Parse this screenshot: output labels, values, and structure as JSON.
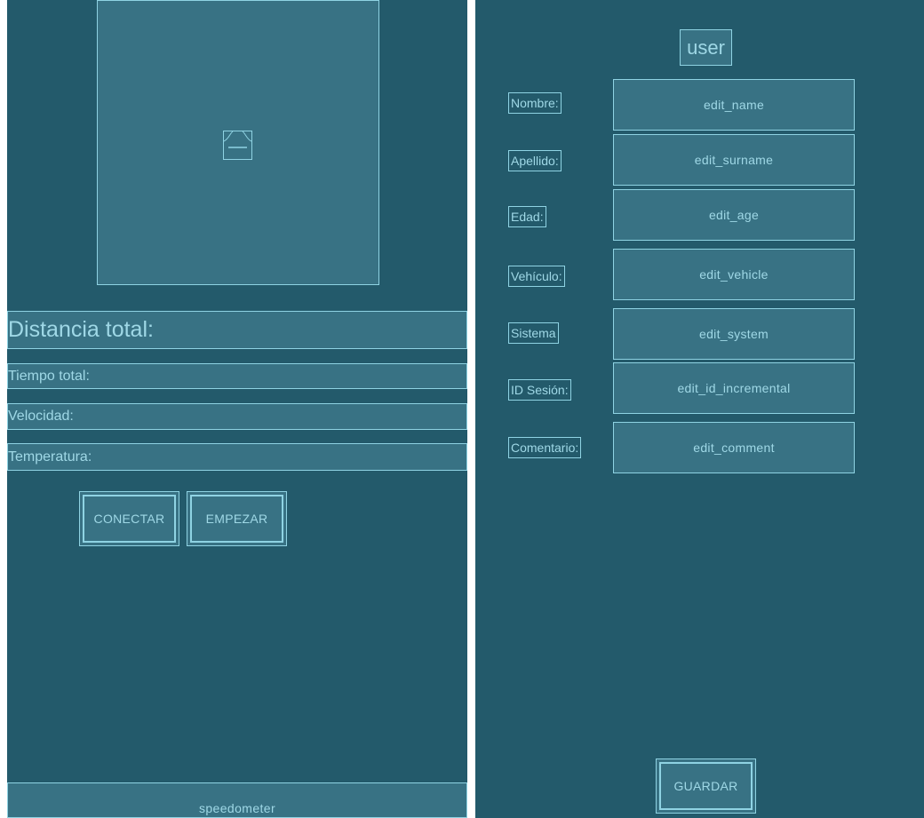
{
  "speedometer_screen": {
    "image_placeholder_icon": "broken-image-icon",
    "stats": {
      "distance_label": "Distancia total:",
      "time_label": "Tiempo total:",
      "speed_label": "Velocidad:",
      "temperature_label": "Temperatura:"
    },
    "buttons": {
      "connect_label": "CONECTAR",
      "start_label": "EMPEZAR"
    },
    "footer_label": "speedometer"
  },
  "user_screen": {
    "title": "user",
    "fields": [
      {
        "label": "Nombre:",
        "value": "edit_name"
      },
      {
        "label": "Apellido:",
        "value": "edit_surname"
      },
      {
        "label": "Edad:",
        "value": "edit_age"
      },
      {
        "label": "Vehículo:",
        "value": "edit_vehicle"
      },
      {
        "label": "Sistema",
        "value": "edit_system"
      },
      {
        "label": "ID Sesión:",
        "value": "edit_id_incremental"
      },
      {
        "label": "Comentario:",
        "value": "edit_comment"
      }
    ],
    "save_label": "GUARDAR"
  },
  "colors": {
    "background": "#235a6b",
    "surface": "#387284",
    "border": "#8fd3e3",
    "text": "#9fd8e6"
  }
}
